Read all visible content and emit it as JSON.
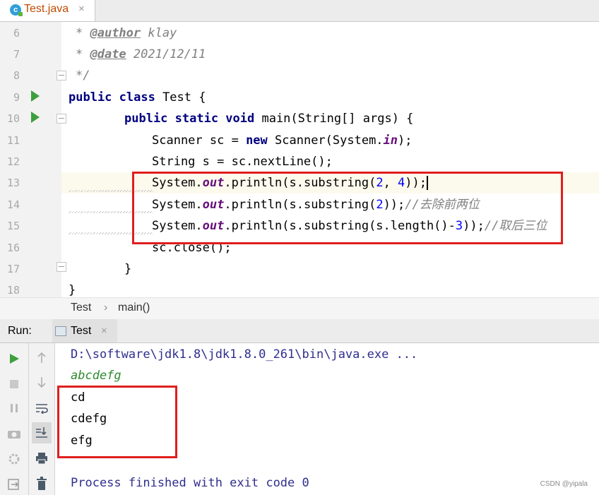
{
  "tab": {
    "name": "Test.java",
    "close": "×",
    "icon": "java-class-icon"
  },
  "editor": {
    "line_numbers": [
      "6",
      "7",
      "8",
      "9",
      "10",
      "11",
      "12",
      "13",
      "14",
      "15",
      "16",
      "17",
      "18"
    ],
    "lines": {
      "l6": {
        "prefix": "* ",
        "tag": "@author",
        "rest": " klay"
      },
      "l7": {
        "prefix": "* ",
        "tag": "@date",
        "rest": " 2021/12/11"
      },
      "l8": {
        "text": "*/"
      },
      "l9": {
        "kw": "public class",
        "rest": " Test {"
      },
      "l10": {
        "kw": "public static void",
        "rest": " main(String[] args) {"
      },
      "l11": {
        "a": "Scanner sc = ",
        "kw": "new",
        "b": " Scanner(System.",
        "fld": "in",
        "c": ");"
      },
      "l12": {
        "text": "String s = sc.nextLine();"
      },
      "l13": {
        "a": "System.",
        "fld": "out",
        "b": ".println(s.substring(",
        "n1": "2",
        "sep": ", ",
        "n2": "4",
        "c": "));"
      },
      "l14": {
        "a": "System.",
        "fld": "out",
        "b": ".println(s.substring(",
        "n1": "2",
        "c": "));",
        "comment": "//去除前两位"
      },
      "l15": {
        "a": "System.",
        "fld": "out",
        "b": ".println(s.substring(s.length()-",
        "n1": "3",
        "c": "));",
        "comment": "//取后三位"
      },
      "l16": {
        "text": "sc.close();"
      },
      "l17": {
        "text": "}"
      },
      "l18": {
        "text": "}"
      }
    },
    "colors": {
      "keyword": "#000080",
      "comment": "#808080",
      "field": "#660e7a",
      "number": "#0000ff",
      "highlight_box": "#e01e1e"
    }
  },
  "breadcrumb": {
    "class": "Test",
    "separator": "›",
    "method": "main()"
  },
  "run": {
    "label": "Run:",
    "tab_name": "Test",
    "tab_close": "×",
    "console": {
      "command": "D:\\software\\jdk1.8\\jdk1.8.0_261\\bin\\java.exe ...",
      "input": "abcdefg",
      "outputs": [
        "cd",
        "cdefg",
        "efg"
      ],
      "finished": "Process finished with exit code 0"
    },
    "toolbar_icons": [
      "rerun-icon",
      "up-arrow-icon",
      "stop-icon",
      "down-arrow-icon",
      "pause-icon",
      "soft-wrap-icon",
      "camera-icon",
      "scroll-to-end-icon",
      "settings-icon",
      "print-icon",
      "exit-icon",
      "trash-icon"
    ]
  },
  "watermark": "CSDN @yipala"
}
